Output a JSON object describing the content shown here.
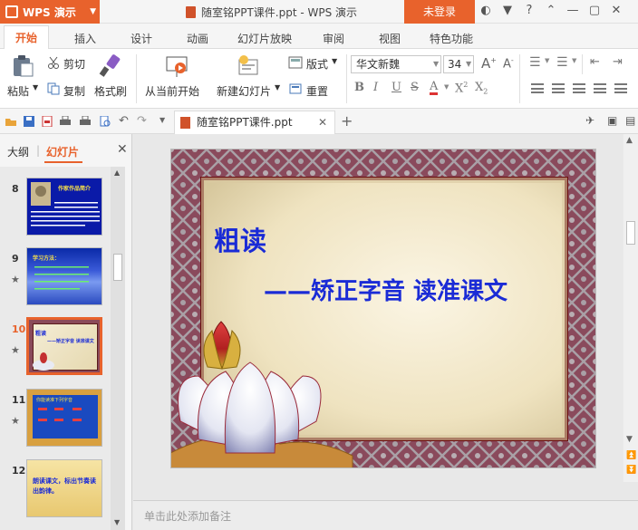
{
  "app": {
    "name": "WPS 演示",
    "doc_title": "随室铭PPT课件.ppt - WPS 演示",
    "login": "未登录"
  },
  "ribbon_tabs": [
    "开始",
    "插入",
    "设计",
    "动画",
    "幻灯片放映",
    "审阅",
    "视图",
    "特色功能"
  ],
  "toolbar": {
    "paste": "粘贴",
    "cut": "剪切",
    "copy": "复制",
    "format_painter": "格式刷",
    "from_current": "从当前开始",
    "new_slide": "新建幻灯片",
    "layout": "版式",
    "reset": "重置",
    "font_name": "华文新魏",
    "font_size": "34"
  },
  "doc_tab": {
    "name": "随室铭PPT课件.ppt"
  },
  "left_pane": {
    "outline_tab": "大纲",
    "slides_tab": "幻灯片"
  },
  "thumbnails": [
    {
      "num": "8",
      "title": "作家作品简介"
    },
    {
      "num": "9",
      "title": "学习方法："
    },
    {
      "num": "10",
      "title": "粗读",
      "sub": "——矫正字音 读准课文"
    },
    {
      "num": "11",
      "title": "你能读准下列字音"
    },
    {
      "num": "12",
      "title": "朗读课文，标出节奏读出韵律。"
    }
  ],
  "slide": {
    "title": "粗读",
    "subtitle": "——矫正字音 读准课文"
  },
  "notes": {
    "placeholder": "单击此处添加备注"
  },
  "colors": {
    "accent": "#e8622c",
    "slide_text": "#1a2bd6",
    "frame": "#7a3a4a"
  }
}
